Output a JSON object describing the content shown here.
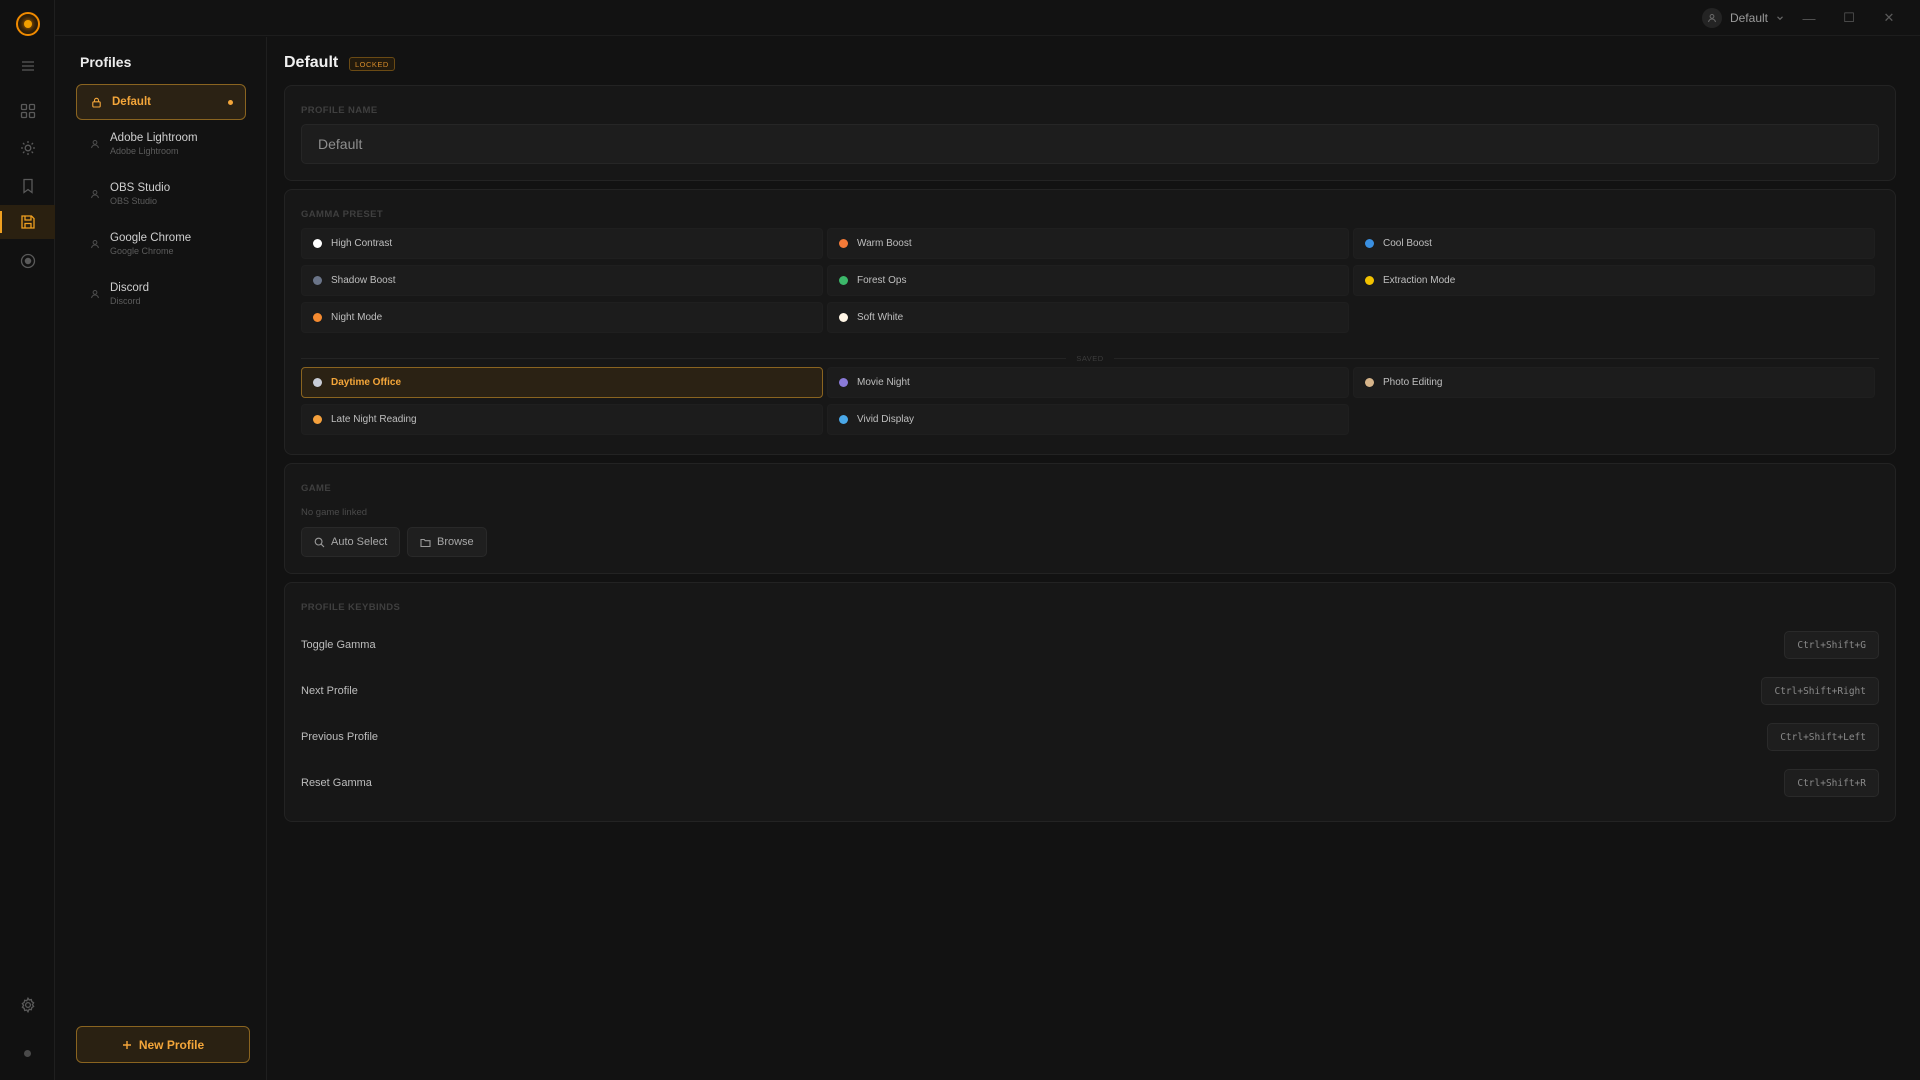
{
  "titlebar": {
    "user_label": "Default",
    "controls": {
      "minimize": "—",
      "maximize": "☐",
      "close": "✕"
    }
  },
  "rail": {
    "items": [
      {
        "icon": "menu-icon"
      },
      {
        "icon": "grid-icon"
      },
      {
        "icon": "brightness-icon"
      },
      {
        "icon": "bookmark-icon"
      },
      {
        "icon": "save-icon",
        "active": true
      },
      {
        "icon": "record-icon"
      },
      {
        "icon": "settings-icon"
      }
    ]
  },
  "sidebar": {
    "title": "Profiles",
    "profiles": [
      {
        "name": "Default",
        "sub": "",
        "selected": true,
        "icon": "lock-icon"
      },
      {
        "name": "Adobe Lightroom",
        "sub": "Adobe Lightroom",
        "icon": "user-icon"
      },
      {
        "name": "OBS Studio",
        "sub": "OBS Studio",
        "icon": "user-icon"
      },
      {
        "name": "Google Chrome",
        "sub": "Google Chrome",
        "icon": "user-icon"
      },
      {
        "name": "Discord",
        "sub": "Discord",
        "icon": "user-icon"
      }
    ],
    "new_profile_label": "New Profile"
  },
  "main": {
    "title": "Default",
    "badge": "LOCKED",
    "profile_name": {
      "label": "PROFILE NAME",
      "value": "Default"
    },
    "gamma_preset": {
      "label": "GAMMA PRESET",
      "presets": [
        {
          "name": "High Contrast",
          "color": "#ffffff"
        },
        {
          "name": "Warm Boost",
          "color": "#f47a38"
        },
        {
          "name": "Cool Boost",
          "color": "#3a8fe0"
        },
        {
          "name": "Shadow Boost",
          "color": "#6a7488"
        },
        {
          "name": "Forest Ops",
          "color": "#3cb86a"
        },
        {
          "name": "Extraction Mode",
          "color": "#f2c200"
        },
        {
          "name": "Night Mode",
          "color": "#f48a30"
        },
        {
          "name": "Soft White",
          "color": "#fff6e6"
        }
      ],
      "saved_label": "SAVED",
      "saved": [
        {
          "name": "Daytime Office",
          "color": "#c8ccd6",
          "selected": true
        },
        {
          "name": "Movie Night",
          "color": "#8a7ad8"
        },
        {
          "name": "Photo Editing",
          "color": "#d6b48a"
        },
        {
          "name": "Late Night Reading",
          "color": "#f4a03c"
        },
        {
          "name": "Vivid Display",
          "color": "#4aa8e8"
        }
      ]
    },
    "game": {
      "label": "GAME",
      "note": "No game linked",
      "auto_select_label": "Auto Select",
      "browse_label": "Browse"
    },
    "keybinds": {
      "label": "PROFILE KEYBINDS",
      "rows": [
        {
          "action": "Toggle Gamma",
          "key": "Ctrl+Shift+G"
        },
        {
          "action": "Next Profile",
          "key": "Ctrl+Shift+Right"
        },
        {
          "action": "Previous Profile",
          "key": "Ctrl+Shift+Left"
        },
        {
          "action": "Reset Gamma",
          "key": "Ctrl+Shift+R"
        }
      ]
    }
  },
  "colors": {
    "accent": "#f4a63a",
    "accent_border": "#8a6420",
    "selected_bg": "#2b2214",
    "background": "#121212",
    "card": "#171717"
  }
}
